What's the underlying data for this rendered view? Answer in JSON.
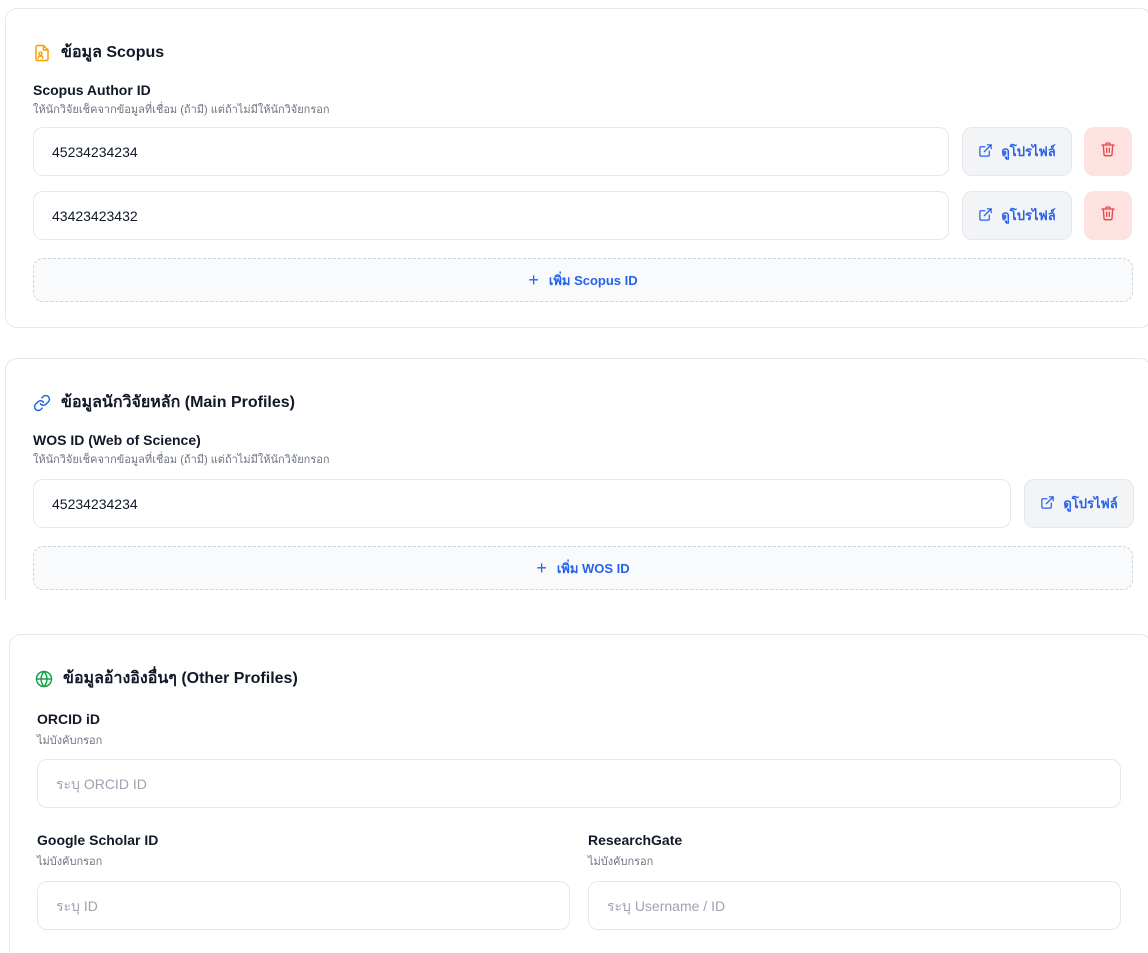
{
  "scopus": {
    "title": "ข้อมูล Scopus",
    "field_label": "Scopus Author ID",
    "field_hint": "ให้นักวิจัยเช็คจากข้อมูลที่เชื่อม (ถ้ามี) แต่ถ้าไม่มีให้นักวิจัยกรอก",
    "entries": [
      "45234234234",
      "43423423432"
    ],
    "view_profile_label": "ดูโปรไฟล์",
    "add_label": "เพิ่ม Scopus ID",
    "icon": "document-user-icon",
    "icon_color": "#f59e0b"
  },
  "main_profiles": {
    "title": "ข้อมูลนักวิจัยหลัก (Main Profiles)",
    "field_label": "WOS ID (Web of Science)",
    "field_hint": "ให้นักวิจัยเช็คจากข้อมูลที่เชื่อม (ถ้ามี) แต่ถ้าไม่มีให้นักวิจัยกรอก",
    "entries": [
      "45234234234"
    ],
    "view_profile_label": "ดูโปรไฟล์",
    "add_label": "เพิ่ม WOS ID",
    "icon": "link-icon",
    "icon_color": "#2563eb"
  },
  "other_profiles": {
    "title": "ข้อมูลอ้างอิงอื่นๆ (Other Profiles)",
    "icon": "globe-icon",
    "icon_color": "#16a34a",
    "orcid": {
      "label": "ORCID iD",
      "hint": "ไม่บังคับกรอก",
      "placeholder": "ระบุ ORCID ID",
      "value": ""
    },
    "google_scholar": {
      "label": "Google Scholar ID",
      "hint": "ไม่บังคับกรอก",
      "placeholder": "ระบุ ID",
      "value": ""
    },
    "researchgate": {
      "label": "ResearchGate",
      "hint": "ไม่บังคับกรอก",
      "placeholder": "ระบุ Username / ID",
      "value": ""
    }
  },
  "colors": {
    "accent": "#2563eb",
    "danger": "#ef4444",
    "danger_bg": "#fee2e2"
  }
}
